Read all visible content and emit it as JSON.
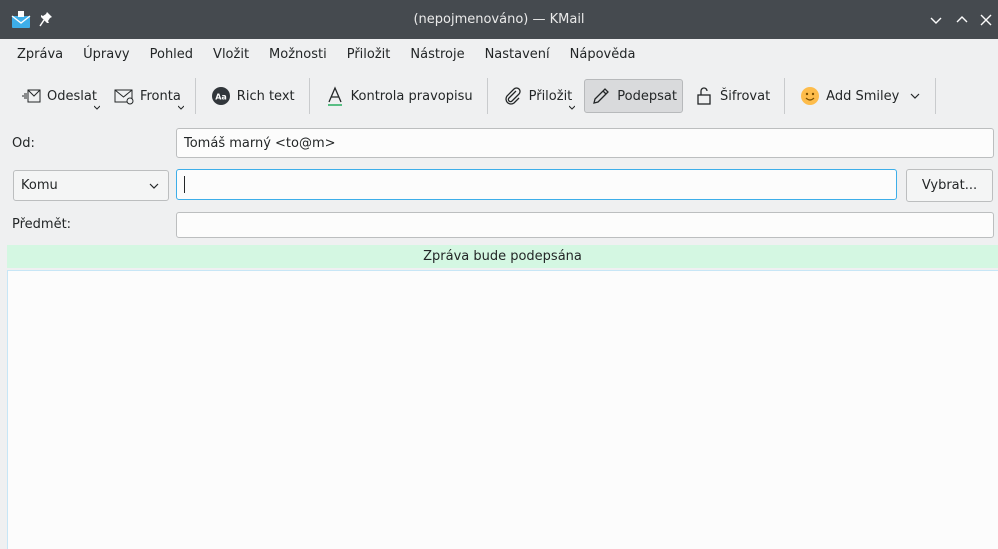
{
  "window": {
    "title": "(nepojmenováno) — KMail"
  },
  "menu": [
    "Zpráva",
    "Úpravy",
    "Pohled",
    "Vložit",
    "Možnosti",
    "Přiložit",
    "Nástroje",
    "Nastavení",
    "Nápověda"
  ],
  "toolbar": {
    "send": "Odeslat",
    "queue": "Fronta",
    "rich_text": "Rich text",
    "spellcheck": "Kontrola pravopisu",
    "attach": "Přiložit",
    "sign": "Podepsat",
    "encrypt": "Šifrovat",
    "smiley": "Add Smiley"
  },
  "form": {
    "from_label": "Od:",
    "from_value": "Tomáš marný <to@m>",
    "recipient_type": "Komu",
    "recipient_value": "",
    "select_button": "Vybrat...",
    "subject_label": "Předmět:",
    "subject_value": ""
  },
  "banner": {
    "sign_notice": "Zpráva bude podepsána"
  },
  "colors": {
    "titlebar": "#454a4f",
    "banner": "#d4f7e2",
    "focus": "#3daee9"
  }
}
